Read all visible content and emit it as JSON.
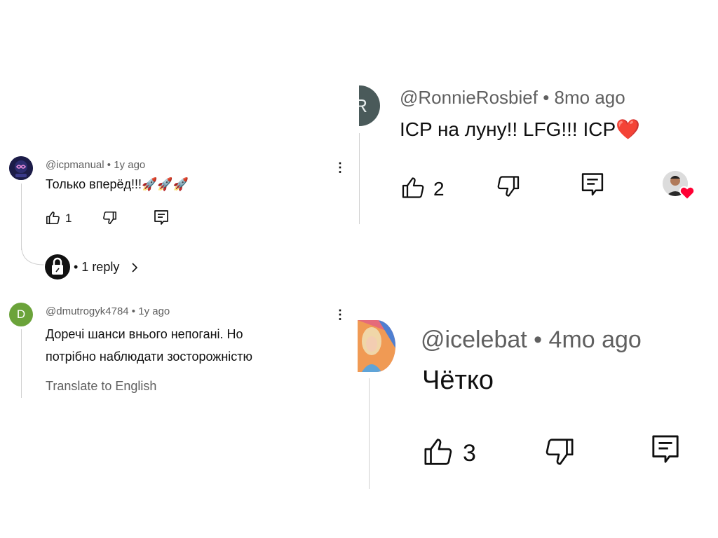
{
  "left_panel": {
    "comment1": {
      "author": "@icpmanual",
      "sep": "•",
      "time": "1y ago",
      "text": "Только вперёд!!!🚀🚀🚀",
      "likes": "1",
      "replies_label": "• 1 reply"
    },
    "comment2": {
      "avatar_letter": "D",
      "author": "@dmutrogyk4784",
      "sep": "•",
      "time": "1y ago",
      "text_line1": "Доречі шанси внього непогані. Но",
      "text_line2": "потрібно наблюдати зосторожністю",
      "translate": "Translate to English"
    }
  },
  "right_panel": {
    "comment1": {
      "avatar_letter": "R",
      "author": "@RonnieRosbief",
      "sep": "•",
      "time": "8mo ago",
      "text": "ICP на луну!! LFG!!! ICP",
      "heart": "❤️",
      "likes": "2"
    },
    "comment2": {
      "author": "@icelebat",
      "sep": "•",
      "time": "4mo ago",
      "text": "Чётко",
      "likes": "3"
    }
  },
  "colors": {
    "meta_gray": "#606060",
    "avatar_d": "#6ba33a",
    "avatar_r": "#4a5a5a",
    "heart": "#ff0033"
  }
}
